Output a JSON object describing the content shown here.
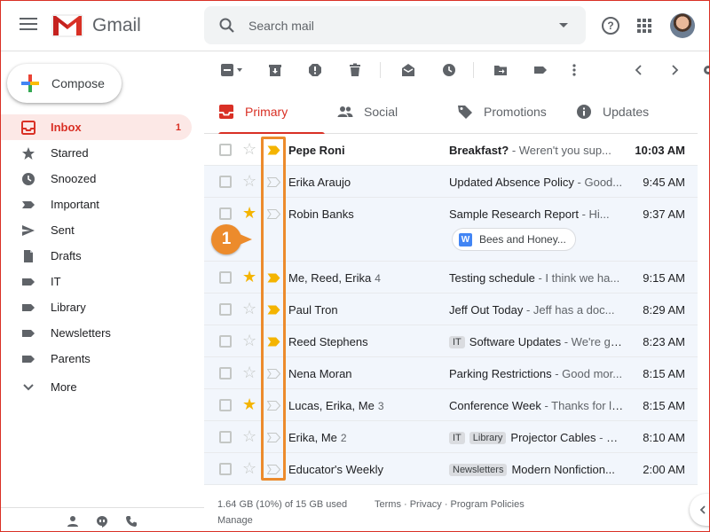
{
  "app": {
    "title": "Gmail"
  },
  "search": {
    "placeholder": "Search mail"
  },
  "compose": {
    "label": "Compose"
  },
  "sidebar": {
    "items": [
      {
        "label": "Inbox",
        "count": "1",
        "icon": "inbox-icon",
        "active": true
      },
      {
        "label": "Starred",
        "icon": "star-icon"
      },
      {
        "label": "Snoozed",
        "icon": "clock-icon"
      },
      {
        "label": "Important",
        "icon": "important-icon"
      },
      {
        "label": "Sent",
        "icon": "send-icon"
      },
      {
        "label": "Drafts",
        "icon": "draft-icon"
      },
      {
        "label": "IT",
        "icon": "label-icon"
      },
      {
        "label": "Library",
        "icon": "label-icon"
      },
      {
        "label": "Newsletters",
        "icon": "label-icon"
      },
      {
        "label": "Parents",
        "icon": "label-icon"
      }
    ],
    "more": "More"
  },
  "tabs": [
    {
      "label": "Primary",
      "icon": "inbox-icon",
      "active": true
    },
    {
      "label": "Social",
      "icon": "people-icon"
    },
    {
      "label": "Promotions",
      "icon": "tag-icon"
    },
    {
      "label": "Updates",
      "icon": "info-icon"
    }
  ],
  "emails": [
    {
      "sender": "Pepe Roni",
      "count": "",
      "subject": "Breakfast?",
      "snippet": " - Weren't you sup...",
      "time": "10:03 AM",
      "starred": false,
      "important": true,
      "unread": true,
      "labels": []
    },
    {
      "sender": "Erika Araujo",
      "count": "",
      "subject": "Updated Absence Policy",
      "snippet": " - Good...",
      "time": "9:45 AM",
      "starred": false,
      "important": false,
      "unread": false,
      "labels": []
    },
    {
      "sender": "Robin Banks",
      "count": "",
      "subject": "Sample Research Report",
      "snippet": " - Hi...",
      "time": "9:37 AM",
      "starred": true,
      "important": false,
      "unread": false,
      "labels": [],
      "attachment": "Bees and Honey..."
    },
    {
      "sender": "Me, Reed, Erika",
      "count": "4",
      "subject": "Testing schedule",
      "snippet": " - I think we ha...",
      "time": "9:15 AM",
      "starred": true,
      "important": true,
      "unread": false,
      "labels": []
    },
    {
      "sender": "Paul Tron",
      "count": "",
      "subject": "Jeff Out Today",
      "snippet": "  - Jeff has a doc...",
      "time": "8:29 AM",
      "starred": false,
      "important": true,
      "unread": false,
      "labels": []
    },
    {
      "sender": "Reed Stephens",
      "count": "",
      "subject": "Software Updates",
      "snippet": " - We're go...",
      "time": "8:23 AM",
      "starred": false,
      "important": true,
      "unread": false,
      "labels": [
        "IT"
      ]
    },
    {
      "sender": "Nena Moran",
      "count": "",
      "subject": "Parking Restrictions",
      "snippet": " - Good mor...",
      "time": "8:15 AM",
      "starred": false,
      "important": false,
      "unread": false,
      "labels": []
    },
    {
      "sender": "Lucas, Erika, Me",
      "count": "3",
      "subject": "Conference Week",
      "snippet": " - Thanks for le...",
      "time": "8:15 AM",
      "starred": true,
      "important": false,
      "unread": false,
      "labels": []
    },
    {
      "sender": "Erika, Me",
      "count": "2",
      "subject": "Projector Cables",
      "snippet": " - M...",
      "time": "8:10 AM",
      "starred": false,
      "important": false,
      "unread": false,
      "labels": [
        "IT",
        "Library"
      ]
    },
    {
      "sender": "Educator's Weekly",
      "count": "",
      "subject": "Modern Nonfiction...",
      "snippet": "",
      "time": "2:00 AM",
      "starred": false,
      "important": false,
      "unread": false,
      "labels": [
        "Newsletters"
      ]
    }
  ],
  "footer": {
    "storage": "1.64 GB (10%) of 15 GB used",
    "manage": "Manage",
    "links": "Terms · Privacy · Program Policies"
  },
  "annotation": {
    "number": "1"
  },
  "colors": {
    "accent": "#d93025",
    "important": "#f4b400",
    "annotation": "#ec8b2c"
  }
}
